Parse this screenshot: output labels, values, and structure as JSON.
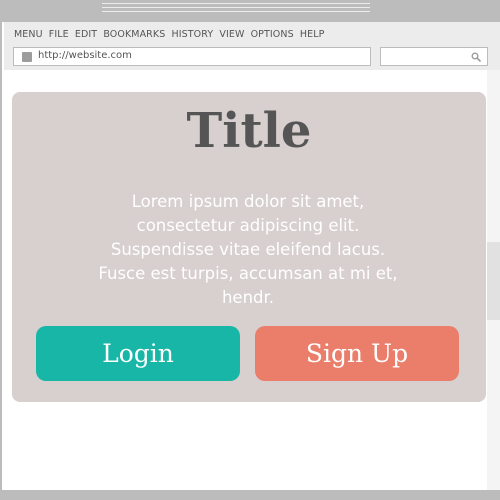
{
  "browser": {
    "menu_items": [
      "MENU",
      "FILE",
      "EDIT",
      "BOOKMARKS",
      "HISTORY",
      "VIEW",
      "OPTIONS",
      "HELP"
    ],
    "address": {
      "url": "http://website.com"
    },
    "search": {
      "placeholder": ""
    }
  },
  "hero": {
    "title": "Title",
    "body": "Lorem ipsum dolor sit amet, consectetur adipiscing elit. Suspendisse vitae eleifend lacus. Fusce est turpis, accumsan at mi et, hendr.",
    "login_label": "Login",
    "signup_label": "Sign Up"
  },
  "colors": {
    "frame": "#bdbcbd",
    "chrome": "#ececec",
    "card": "#d8cfcf",
    "login": "#17b6a7",
    "signup": "#ea7e6a",
    "title_text": "#555555"
  },
  "icons": {
    "favicon": "page-favicon-icon",
    "search": "search-icon"
  }
}
